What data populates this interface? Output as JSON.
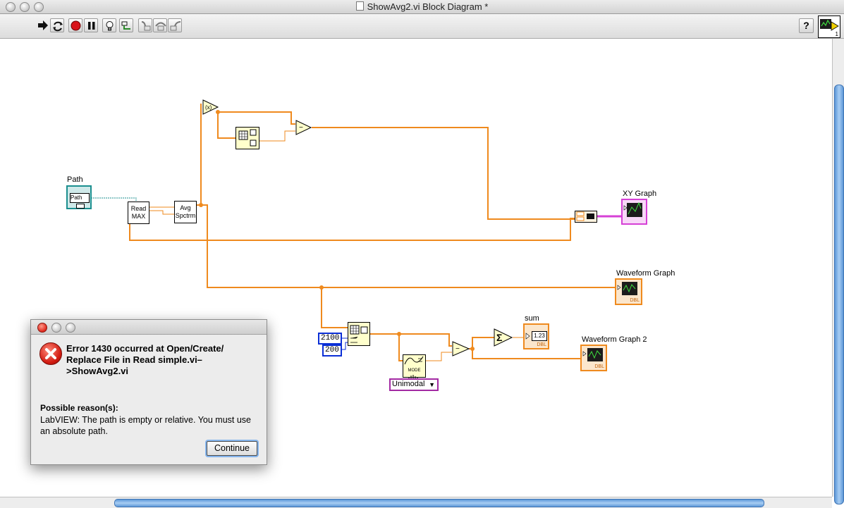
{
  "window": {
    "title": "ShowAvg2.vi Block Diagram *"
  },
  "toolbar": {
    "buttons": [
      {
        "name": "run-arrow-icon"
      },
      {
        "name": "run-continuously-icon"
      },
      {
        "name": "abort-icon"
      },
      {
        "name": "pause-icon"
      },
      {
        "name": "highlight-execution-icon"
      },
      {
        "name": "retain-wire-values-icon"
      },
      {
        "name": "step-into-icon"
      },
      {
        "name": "step-over-icon"
      },
      {
        "name": "step-out-icon"
      }
    ],
    "help_icon": "?",
    "vi_icon_badge": "1"
  },
  "diagram": {
    "path_label": "Path",
    "path_control_text": "Path",
    "read_max_line1": "Read",
    "read_max_line2": "MAX",
    "avg_spctrm_line1": "Avg",
    "avg_spctrm_line2": "Spctrm",
    "xy_graph_label": "XY Graph",
    "waveform_graph_label": "Waveform Graph",
    "waveform_graph2_label": "Waveform Graph 2",
    "sum_label": "sum",
    "sum_indicator_text": "1.23",
    "dbl_tag": "DBL",
    "const_2100": "2100",
    "const_200": "200",
    "mode_text": "MODE",
    "unimodal_value": "Unimodal",
    "sigma_symbol": "Σ",
    "minus_symbol": "−"
  },
  "error_dialog": {
    "title_line": "Error 1430 occurred at Open/Create/ Replace File in Read simple.vi–>ShowAvg2.vi",
    "reason_heading": "Possible reason(s):",
    "reason_text": "LabVIEW:  The path is empty or relative. You must use an absolute path.",
    "continue_label": "Continue"
  },
  "colors": {
    "wire_dbl": "#ef8a1e",
    "wire_path": "#1b8f8f",
    "wire_cluster": "#d640d6",
    "const_border": "#0b2fd6",
    "ring_border": "#a32aa3",
    "scroll_thumb": "#5d98d8"
  }
}
